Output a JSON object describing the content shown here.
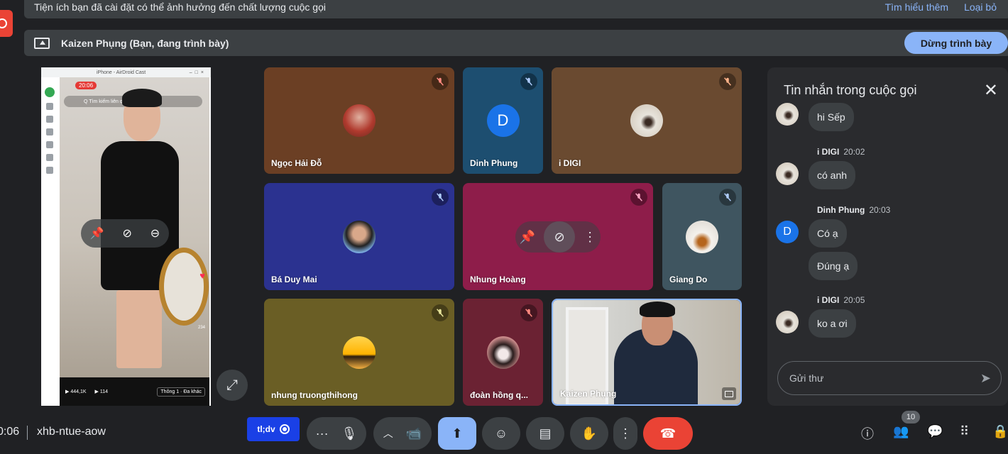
{
  "banner": {
    "warning_text": "Tiện ích bạn đã cài đặt có thể ảnh hưởng đến chất lượng cuộc gọi",
    "learn_more": "Tìm hiểu thêm",
    "dismiss": "Loại bỏ"
  },
  "presenting": {
    "label": "Kaizen Phụng (Bạn, đang trình bày)",
    "stop_button": "Dừng trình bày"
  },
  "phone_share": {
    "window_title": "iPhone - AirDroid Cast",
    "clock": "20:06",
    "search_text": "Q Tìm kiếm liên quan",
    "views": "444,1K",
    "likes": "114",
    "tag": "Thông 1 · Đa khác",
    "side_count": "234"
  },
  "tiles": [
    {
      "name": "Ngọc Hải Đỗ",
      "bg": "#6b3f24",
      "avatar": "photo-red"
    },
    {
      "name": "Dinh Phung",
      "bg": "#1d4e70",
      "avatar_letter": "D"
    },
    {
      "name": "i DIGI",
      "bg": "#6a4a30",
      "avatar": "photo-light"
    },
    {
      "name": "Bá Duy Mai",
      "bg": "#2b3290",
      "avatar": "photo-man"
    },
    {
      "name": "Nhung Hoàng",
      "bg": "#8e1d4a"
    },
    {
      "name": "Giang Do",
      "bg": "#3f5560",
      "avatar": "photo-woman"
    },
    {
      "name": "nhung truongthihong",
      "bg": "#6a5e25",
      "avatar": "photo-sunset"
    },
    {
      "name": "đoàn hồng q...",
      "bg": "#6b2233",
      "avatar": "photo-couple"
    },
    {
      "name": "Kaizen Phụng"
    }
  ],
  "chat": {
    "title": "Tin nhắn trong cuộc gọi",
    "messages": [
      {
        "sender": "",
        "time": "",
        "text": "hi Sếp"
      },
      {
        "sender": "i DIGI",
        "time": "20:02",
        "text": "có anh"
      },
      {
        "sender": "Dinh Phung",
        "time": "20:03",
        "text": "Có ạ",
        "avatar_letter": "D"
      },
      {
        "sender": "",
        "time": "",
        "text": "Đúng ạ"
      },
      {
        "sender": "i DIGI",
        "time": "20:05",
        "text": "ko a ơi"
      }
    ],
    "input_placeholder": "Gửi thư"
  },
  "bottom": {
    "time": "0:06",
    "meeting_code": "xhb-ntue-aow",
    "extension_label": "tl;dv",
    "people_count": "10"
  },
  "colors": {
    "accent": "#8ab4f8",
    "end_call": "#ea4335",
    "background": "#202124"
  }
}
